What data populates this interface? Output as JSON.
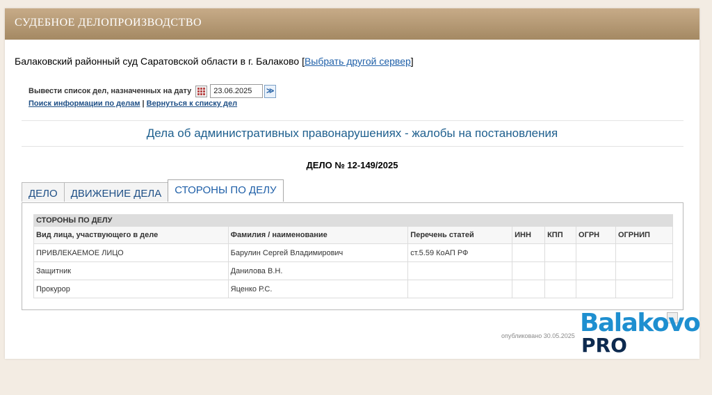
{
  "header": {
    "title": "СУДЕБНОЕ ДЕЛОПРОИЗВОДСТВО"
  },
  "court": {
    "name": "Балаковский районный суд Саратовской области в г. Балаково",
    "open_bracket": " [",
    "server_link": "Выбрать другой сервер",
    "close_bracket": "]"
  },
  "date_filter": {
    "label": "Вывести список дел, назначенных на дату",
    "value": "23.06.2025",
    "go_glyph": "≫"
  },
  "links": {
    "search": "Поиск информации по делам",
    "separator": " | ",
    "back": "Вернуться к списку дел"
  },
  "section_title": "Дела об административных правонарушениях - жалобы на постановления",
  "case_number": "ДЕЛО № 12-149/2025",
  "tabs": [
    {
      "label": "ДЕЛО"
    },
    {
      "label": "ДВИЖЕНИЕ ДЕЛА"
    },
    {
      "label": "СТОРОНЫ ПО ДЕЛУ"
    }
  ],
  "parties_table": {
    "caption": "СТОРОНЫ ПО ДЕЛУ",
    "columns": [
      "Вид лица, участвующего в деле",
      "Фамилия / наименование",
      "Перечень статей",
      "ИНН",
      "КПП",
      "ОГРН",
      "ОГРНИП"
    ],
    "rows": [
      [
        "ПРИВЛЕКАЕМОЕ ЛИЦО",
        "Барулин Сергей Владимирович",
        "ст.5.59 КоАП РФ",
        "",
        "",
        "",
        ""
      ],
      [
        "Защитник",
        "Данилова В.Н.",
        "",
        "",
        "",
        "",
        ""
      ],
      [
        "Прокурор",
        "Яценко Р.С.",
        "",
        "",
        "",
        "",
        ""
      ]
    ]
  },
  "published": "опубликовано 30.05.2025",
  "logo": {
    "top": "Balakovo",
    "bottom": "PRO"
  },
  "colors": {
    "header": "#a48963",
    "link": "#1e5fa8",
    "title": "#1e5f8e",
    "logo_blue": "#1e8fd0",
    "logo_dark": "#0d2a4f"
  }
}
